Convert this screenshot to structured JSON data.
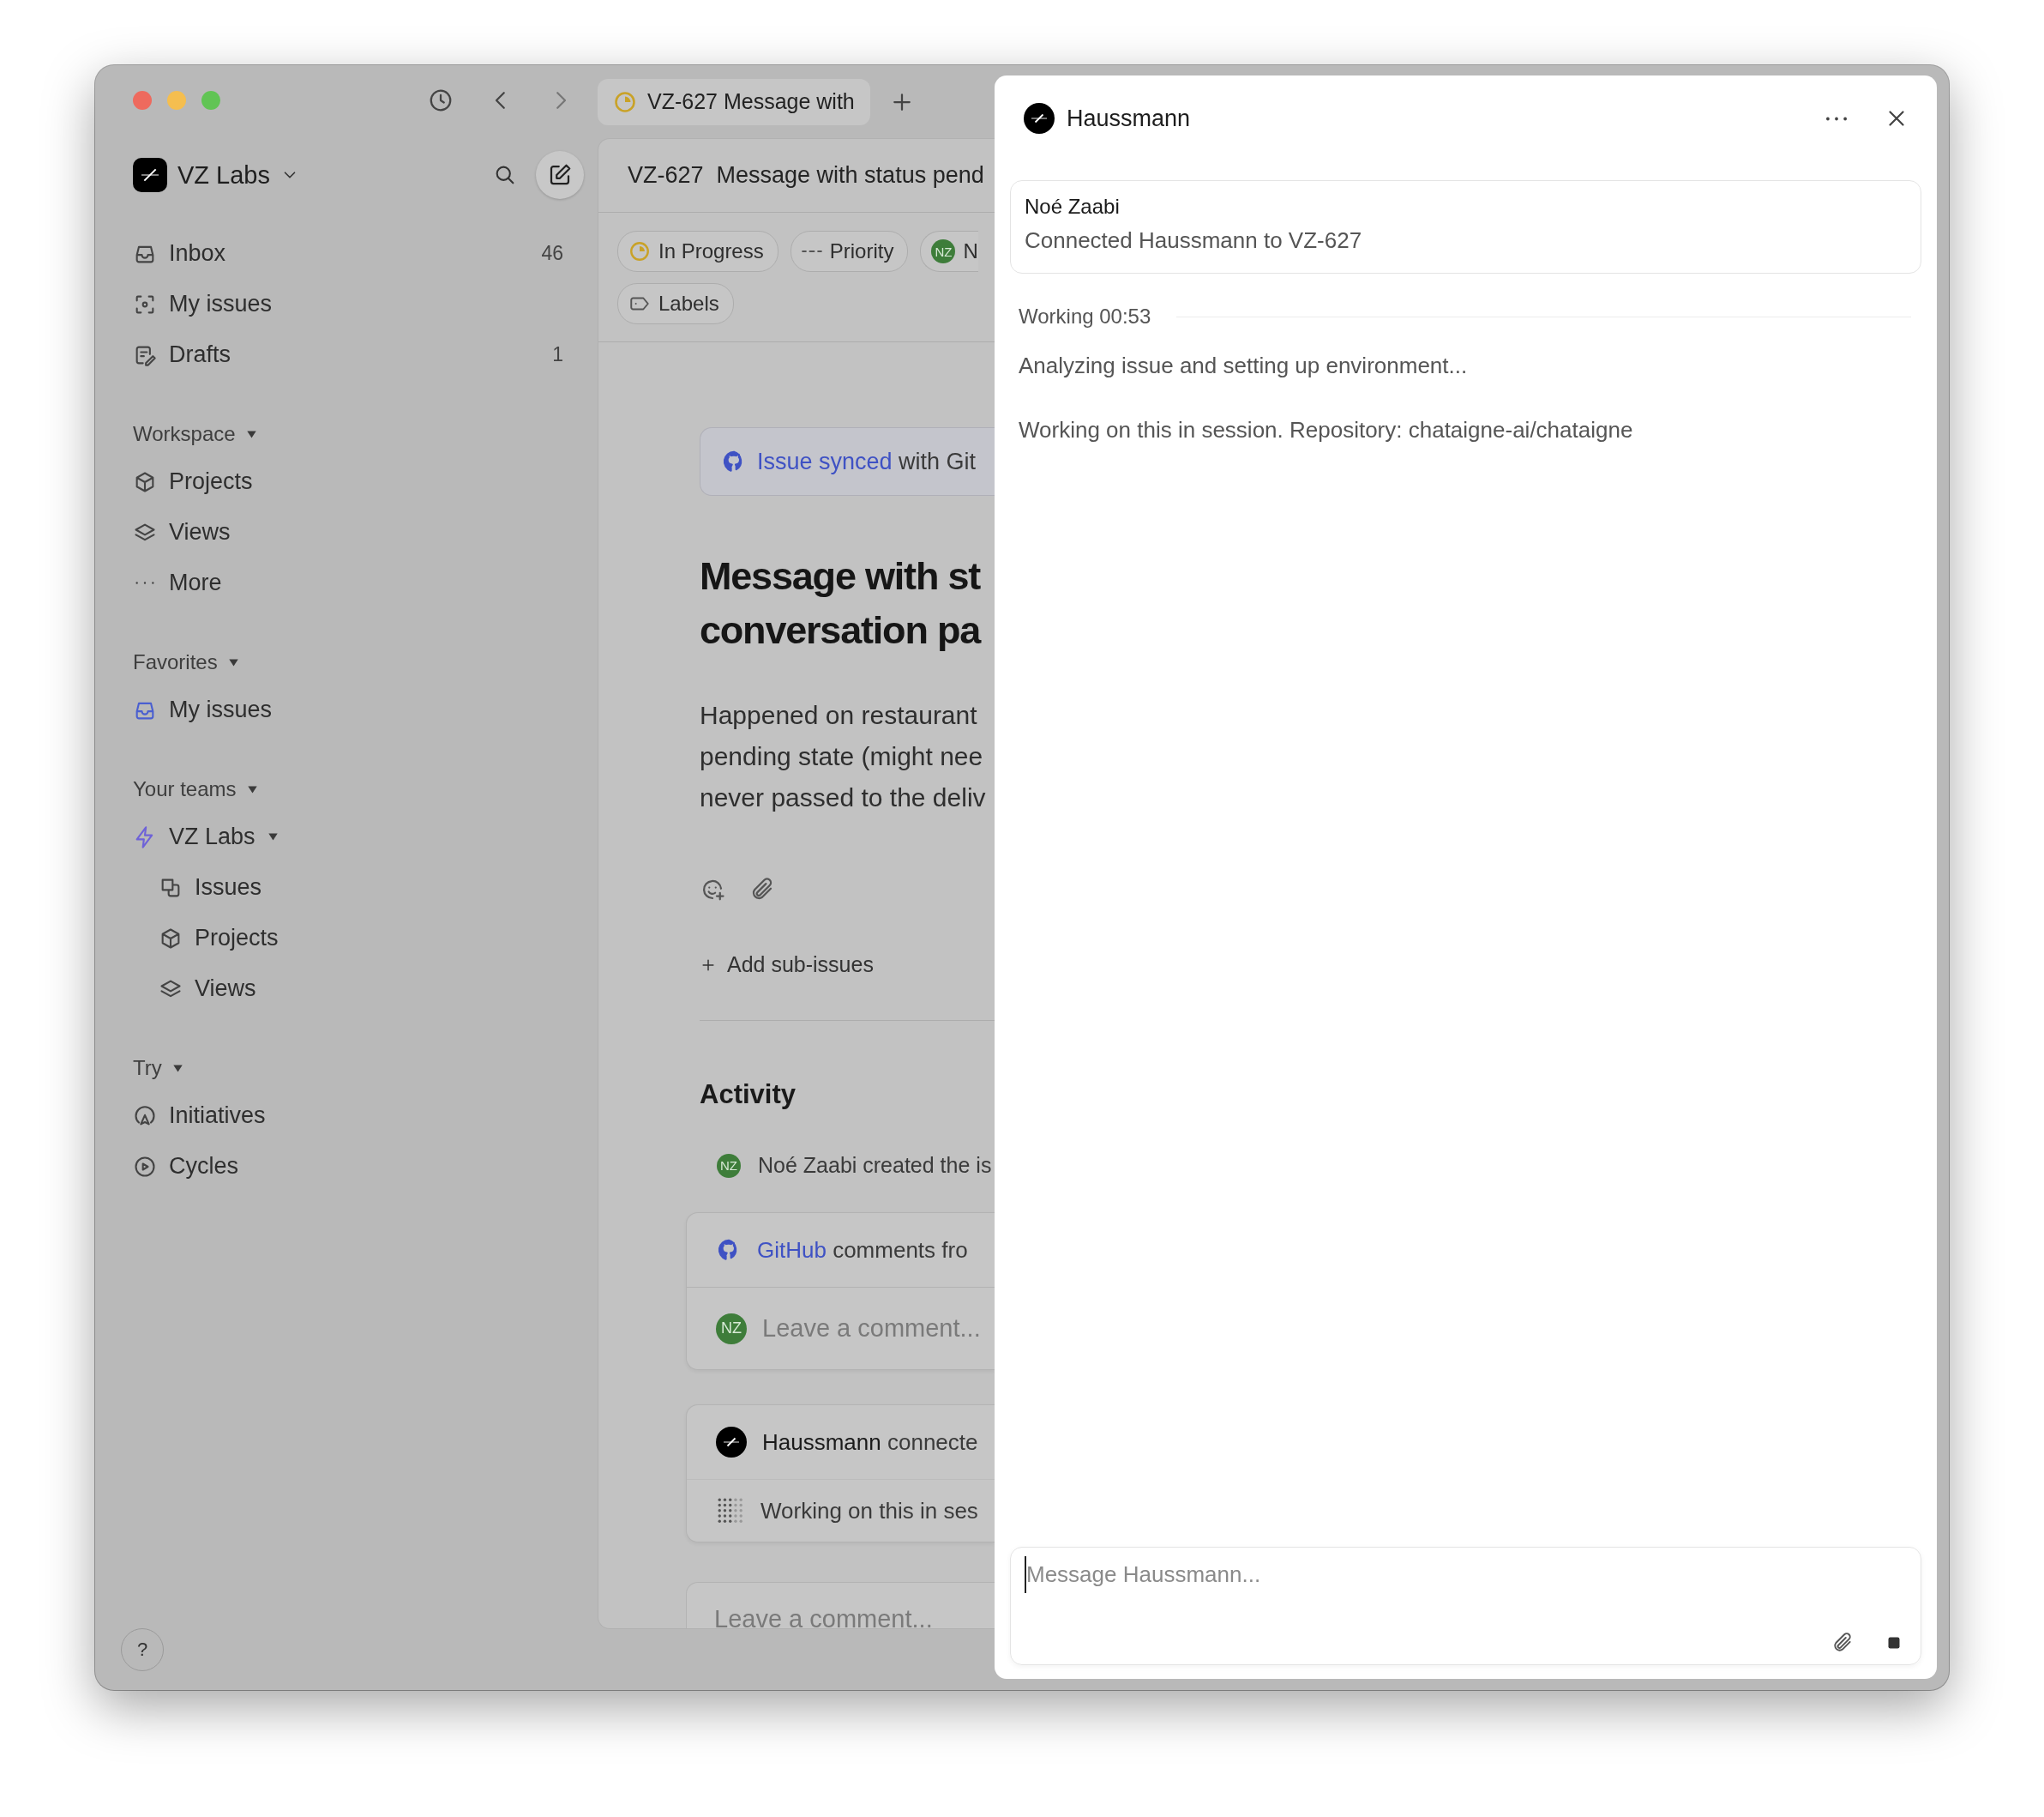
{
  "toolbar": {
    "tab": {
      "title": "VZ-627 Message with"
    }
  },
  "sidebar": {
    "workspace": "VZ Labs",
    "items": [
      {
        "label": "Inbox",
        "count": "46"
      },
      {
        "label": "My issues"
      },
      {
        "label": "Drafts",
        "count": "1"
      }
    ],
    "sections": [
      {
        "title": "Workspace",
        "items": [
          {
            "label": "Projects"
          },
          {
            "label": "Views"
          },
          {
            "label": "More"
          }
        ]
      },
      {
        "title": "Favorites",
        "items": [
          {
            "label": "My issues"
          }
        ]
      },
      {
        "title": "Your teams",
        "items": [
          {
            "label": "VZ Labs",
            "children": [
              {
                "label": "Issues"
              },
              {
                "label": "Projects"
              },
              {
                "label": "Views"
              }
            ]
          }
        ]
      },
      {
        "title": "Try",
        "items": [
          {
            "label": "Initiatives"
          },
          {
            "label": "Cycles"
          }
        ]
      }
    ],
    "help": "?"
  },
  "issue": {
    "id": "VZ-627",
    "title_bar": "Message with status pend",
    "chips": [
      {
        "kind": "status",
        "label": "In Progress"
      },
      {
        "kind": "priority",
        "label": "Priority"
      },
      {
        "kind": "assignee",
        "avatar": "NZ",
        "label": "N"
      },
      {
        "kind": "labels",
        "label": "Labels"
      }
    ],
    "sync_banner": {
      "link": "Issue synced",
      "text": "with Git"
    },
    "title_lines": [
      "Message with st",
      "conversation pa"
    ],
    "description_lines": [
      "Happened on restaurant",
      "pending state (might nee",
      "never passed to the deliv"
    ],
    "add_sub_issues": "Add sub-issues",
    "activity": {
      "heading": "Activity",
      "created": {
        "avatar": "NZ",
        "text": "Noé Zaabi created the is"
      },
      "github_card": {
        "link": "GitHub",
        "text": "comments fro",
        "avatar": "NZ",
        "placeholder": "Leave a comment..."
      },
      "agent_card": {
        "name": "Haussmann",
        "text": "connecte",
        "session": "Working on this in ses"
      },
      "comment_placeholder": "Leave a comment..."
    }
  },
  "agent_panel": {
    "agent": "Haussmann",
    "event": {
      "author": "Noé Zaabi",
      "text": "Connected Haussmann to VZ-627"
    },
    "status": "Working 00:53",
    "messages": [
      "Analyzing issue and setting up environment...",
      "Working on this in session. Repository: chataigne-ai/chataigne"
    ],
    "composer": {
      "placeholder": "Message Haussmann..."
    }
  }
}
